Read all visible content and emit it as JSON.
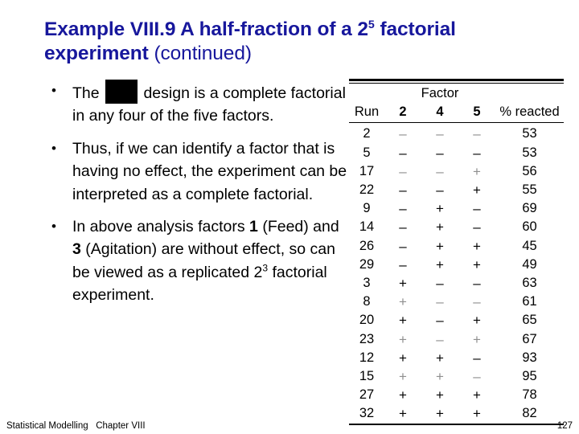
{
  "slide": {
    "title_part1": "Example VIII.9 A half-fraction of a 2",
    "title_sup": "5",
    "title_part2": " factorial experiment ",
    "title_continued": "(continued)",
    "title_color": "#17179c"
  },
  "bullets": [
    {
      "marker": "•",
      "pre_text": "The ",
      "has_redaction": true,
      "post_text": " design is a complete factorial in any four of the five factors."
    },
    {
      "marker": "•",
      "text": "Thus, if we can identify a factor that is having no effect, the experiment can be interpreted as a complete factorial."
    },
    {
      "marker": "•",
      "segments": [
        {
          "t": "In above analysis factors ",
          "bold": false
        },
        {
          "t": "1",
          "bold": true
        },
        {
          "t": " (Feed) and ",
          "bold": false
        },
        {
          "t": "3",
          "bold": true
        },
        {
          "t": " (Agitation) are without effect, so can be viewed as a replicated 2",
          "bold": false
        },
        {
          "t": "3",
          "sup": true
        },
        {
          "t": " factorial experiment.",
          "bold": false
        }
      ]
    }
  ],
  "table": {
    "group_header": "Factor",
    "columns": [
      "Run",
      "2",
      "4",
      "5",
      "% reacted"
    ],
    "rows": [
      {
        "run": "2",
        "f2": "–",
        "f4": "–",
        "f5": "–",
        "pct": "53",
        "faint": true
      },
      {
        "run": "5",
        "f2": "–",
        "f4": "–",
        "f5": "–",
        "pct": "53",
        "faint": false
      },
      {
        "run": "17",
        "f2": "–",
        "f4": "–",
        "f5": "+",
        "pct": "56",
        "faint": true
      },
      {
        "run": "22",
        "f2": "–",
        "f4": "–",
        "f5": "+",
        "pct": "55",
        "faint": false
      },
      {
        "run": "9",
        "f2": "–",
        "f4": "+",
        "f5": "–",
        "pct": "69",
        "faint": false
      },
      {
        "run": "14",
        "f2": "–",
        "f4": "+",
        "f5": "–",
        "pct": "60",
        "faint": false
      },
      {
        "run": "26",
        "f2": "–",
        "f4": "+",
        "f5": "+",
        "pct": "45",
        "faint": false
      },
      {
        "run": "29",
        "f2": "–",
        "f4": "+",
        "f5": "+",
        "pct": "49",
        "faint": false
      },
      {
        "run": "3",
        "f2": "+",
        "f4": "–",
        "f5": "–",
        "pct": "63",
        "faint": false
      },
      {
        "run": "8",
        "f2": "+",
        "f4": "–",
        "f5": "–",
        "pct": "61",
        "faint": true
      },
      {
        "run": "20",
        "f2": "+",
        "f4": "–",
        "f5": "+",
        "pct": "65",
        "faint": false
      },
      {
        "run": "23",
        "f2": "+",
        "f4": "–",
        "f5": "+",
        "pct": "67",
        "faint": true
      },
      {
        "run": "12",
        "f2": "+",
        "f4": "+",
        "f5": "–",
        "pct": "93",
        "faint": false
      },
      {
        "run": "15",
        "f2": "+",
        "f4": "+",
        "f5": "–",
        "pct": "95",
        "faint": true
      },
      {
        "run": "27",
        "f2": "+",
        "f4": "+",
        "f5": "+",
        "pct": "78",
        "faint": false
      },
      {
        "run": "32",
        "f2": "+",
        "f4": "+",
        "f5": "+",
        "pct": "82",
        "faint": false
      }
    ]
  },
  "footer": {
    "left": "Statistical Modelling   Chapter VIII",
    "page": "127"
  }
}
